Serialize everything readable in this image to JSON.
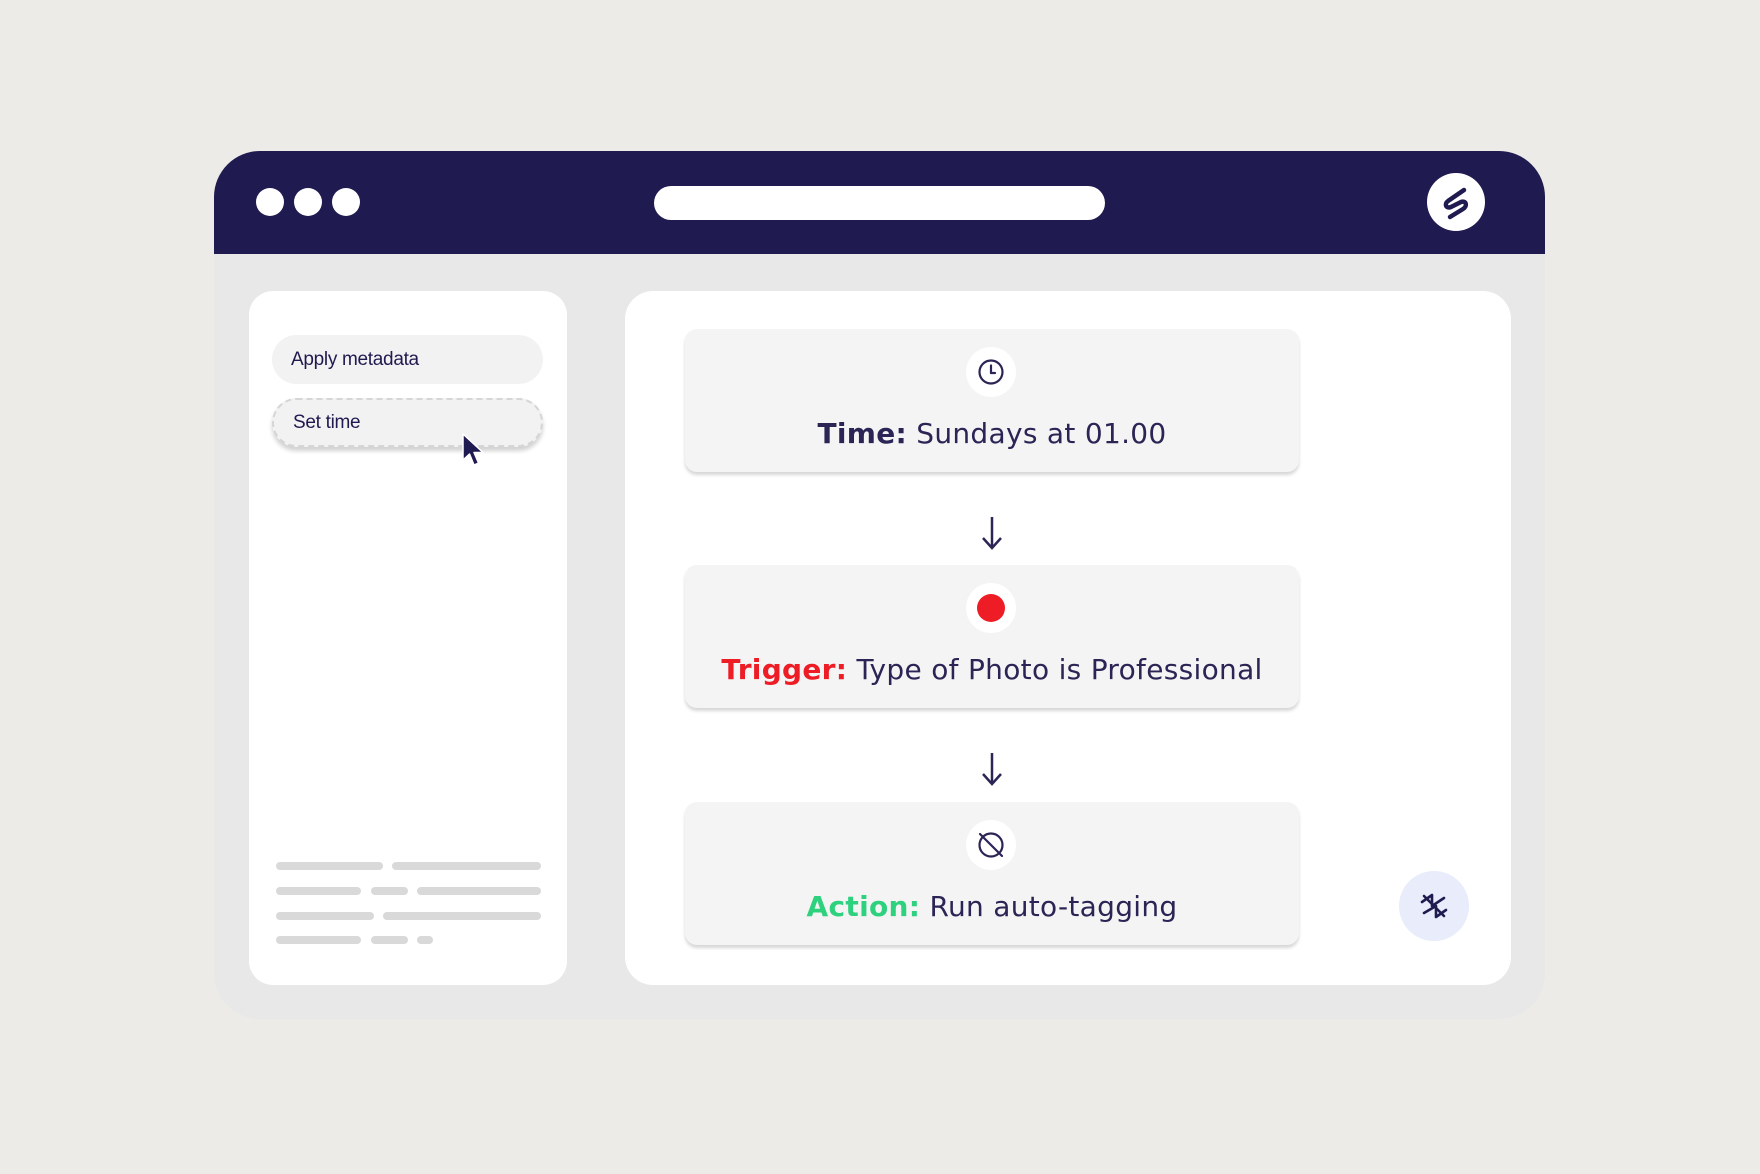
{
  "sidebar": {
    "items": [
      {
        "label": "Apply metadata"
      },
      {
        "label": "Set time"
      }
    ]
  },
  "flow": {
    "steps": [
      {
        "prefix": "Time:",
        "text": "Sundays at 01.00",
        "prefix_color": "#2a2555",
        "icon": "clock-icon"
      },
      {
        "prefix": "Trigger:",
        "text": "Type of Photo is Professional",
        "prefix_color": "#ee1c25",
        "icon": "record-dot-icon"
      },
      {
        "prefix": "Action:",
        "text": "Run auto-tagging",
        "prefix_color": "#2ed17e",
        "icon": "no-view-icon"
      }
    ]
  },
  "colors": {
    "titlebar": "#1f1a4f",
    "background": "#ecebe8",
    "trigger": "#ee1c25",
    "action": "#2ed17e"
  }
}
